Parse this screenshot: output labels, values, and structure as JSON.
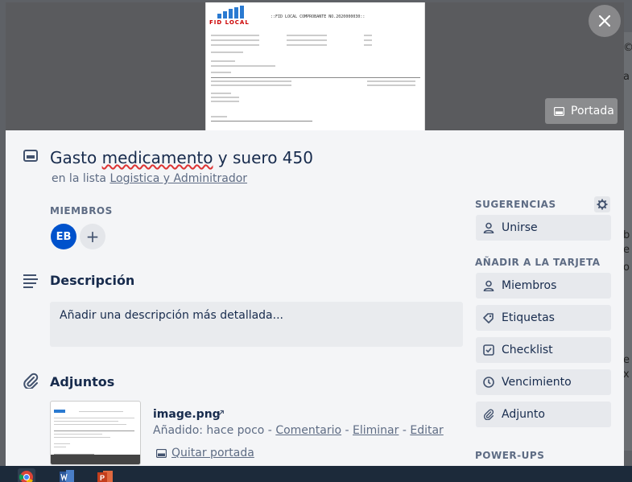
{
  "card": {
    "title_start": "Gasto ",
    "title_misspelled": "medicamento",
    "title_end": " y suero 450",
    "list_prefix": "en la lista ",
    "list_name": "Logistica y Adminitrador"
  },
  "cover": {
    "button_label": "Portada",
    "doc_logo_text": "FID LOCAL",
    "doc_header": "::FID LOCAL COMPROBANTE NO.2020000030::"
  },
  "members": {
    "label": "MIEMBROS",
    "avatar_initials": "EB",
    "add_symbol": "+"
  },
  "description": {
    "title": "Descripción",
    "placeholder": "Añadir una descripción más detallada..."
  },
  "attachments": {
    "title": "Adjuntos",
    "file_name": "image.png",
    "open_symbol": "↗",
    "added_prefix": "Añadido: hace poco - ",
    "comment": "Comentario",
    "delete": "Eliminar",
    "edit": "Editar",
    "separator": " - ",
    "remove_cover": "Quitar portada"
  },
  "sidebar": {
    "suggestions_label": "SUGERENCIAS",
    "join": "Unirse",
    "add_label": "AÑADIR A LA TARJETA",
    "buttons": [
      "Miembros",
      "Etiquetas",
      "Checklist",
      "Vencimiento",
      "Adjunto"
    ],
    "powerups_label": "POWER-UPS"
  },
  "colors": {
    "avatar": "#0052cc",
    "modal_bg": "#f4f5f7",
    "button_bg": "#e7e9ed",
    "text": "#172b4d",
    "muted": "#5e6c84"
  },
  "icons": {
    "title": "card-icon",
    "description": "description-lines-icon",
    "attachments": "paperclip-icon",
    "close": "close-icon",
    "gear": "gear-icon"
  }
}
